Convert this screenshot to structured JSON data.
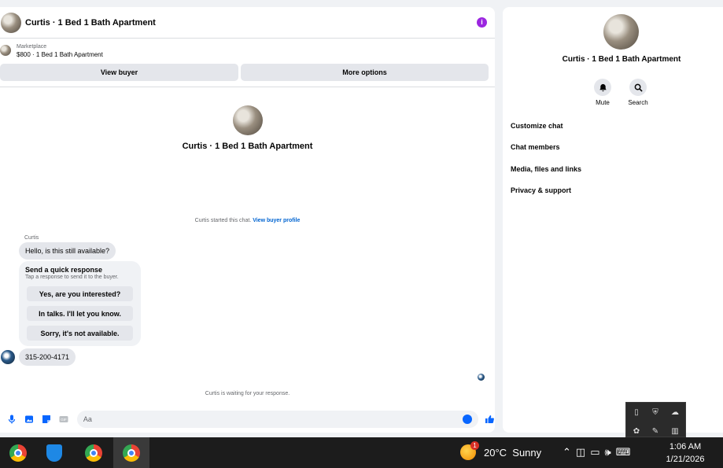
{
  "chat": {
    "header_title": "Curtis · 1 Bed 1 Bath Apartment",
    "listing_kicker": "Marketplace",
    "listing_detail": "$800 · 1 Bed 1 Bath Apartment",
    "view_buyer_label": "View buyer",
    "more_options_label": "More options",
    "intro_title": "Curtis · 1 Bed 1 Bath Apartment",
    "started_text": "Curtis started this chat.",
    "view_profile_link": "View buyer profile",
    "sender_name": "Curtis",
    "first_message": "Hello, is this still available?",
    "quick_response": {
      "title": "Send a quick response",
      "subtitle": "Tap a response to send it to the buyer.",
      "options": [
        "Yes, are you interested?",
        "In talks. I'll let you know.",
        "Sorry, it's not available."
      ]
    },
    "phone_message": "315-200-4171",
    "waiting_text": "Curtis is waiting for your response.",
    "input_placeholder": "Aa",
    "accent_color": "#0866ff"
  },
  "side": {
    "title": "Curtis · 1 Bed 1 Bath Apartment",
    "actions": [
      {
        "label": "Mute",
        "icon": "bell-icon"
      },
      {
        "label": "Search",
        "icon": "search-icon"
      }
    ],
    "menu": [
      "Customize chat",
      "Chat members",
      "Media, files and links",
      "Privacy & support"
    ]
  },
  "taskbar": {
    "temperature": "20°C",
    "condition": "Sunny",
    "weather_badge": "1",
    "time": "1:06 AM",
    "date": "1/21/2026"
  }
}
